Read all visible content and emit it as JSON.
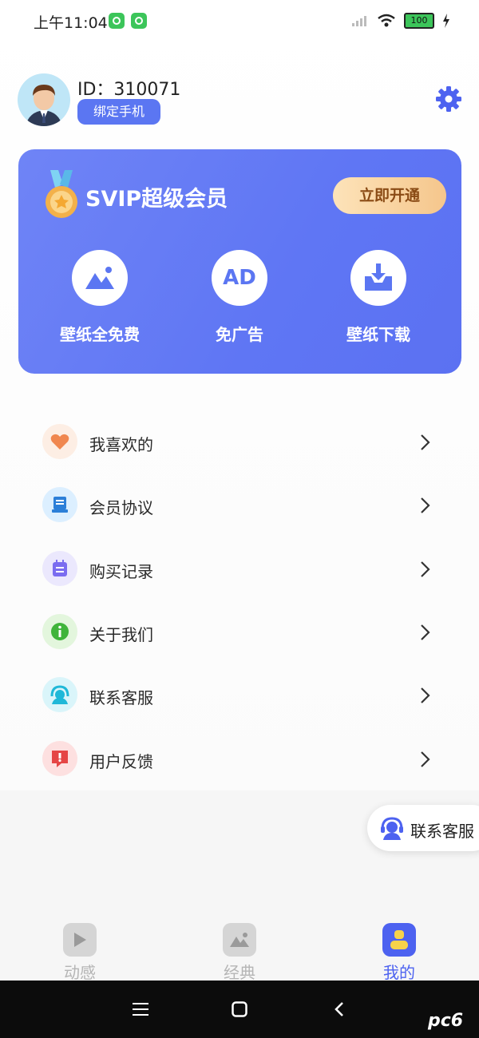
{
  "status_bar": {
    "time": "上午11:04",
    "battery": "100"
  },
  "profile": {
    "id_text": "ID：310071",
    "bind_button": "绑定手机"
  },
  "vip": {
    "title": "SVIP超级会员",
    "open_button": "立即开通",
    "benefits": [
      {
        "label": "壁纸全免费",
        "icon": "image-icon"
      },
      {
        "label": "免广告",
        "icon": "ad-icon",
        "icon_text": "AD"
      },
      {
        "label": "壁纸下载",
        "icon": "download-icon"
      }
    ]
  },
  "menu": [
    {
      "label": "我喜欢的",
      "icon": "heart-icon"
    },
    {
      "label": "会员协议",
      "icon": "document-icon"
    },
    {
      "label": "购买记录",
      "icon": "record-icon"
    },
    {
      "label": "关于我们",
      "icon": "info-icon"
    },
    {
      "label": "联系客服",
      "icon": "headset-icon"
    },
    {
      "label": "用户反馈",
      "icon": "feedback-icon"
    }
  ],
  "float_service": {
    "label": "联系客服"
  },
  "tabs": [
    {
      "label": "动感",
      "active": false
    },
    {
      "label": "经典",
      "active": false
    },
    {
      "label": "我的",
      "active": true
    }
  ],
  "watermark": "pc6",
  "colors": {
    "accent": "#5b76f2",
    "gold": "#f5c68c",
    "active_tab": "#4d62f0",
    "inactive_tab": "#b5b5b5"
  }
}
